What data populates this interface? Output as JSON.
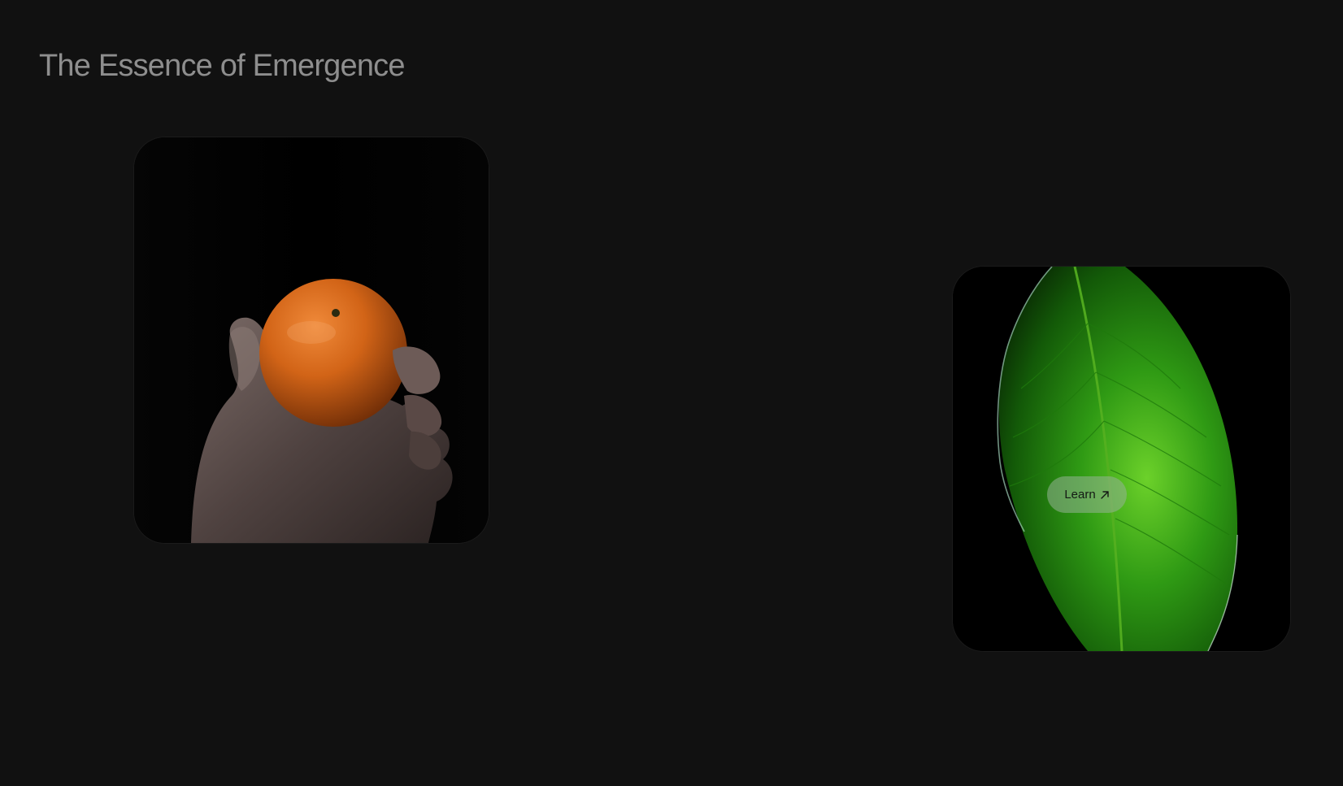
{
  "page": {
    "title": "The Essence of Emergence",
    "background_color": "#111111"
  },
  "cards": [
    {
      "image": "orange-in-hand-photo",
      "accent_color": "#d96a1c"
    },
    {
      "image": "green-leaf-photo",
      "accent_color": "#3fae1e",
      "button": {
        "label": "Learn",
        "icon": "arrow-up-right-icon"
      }
    }
  ]
}
